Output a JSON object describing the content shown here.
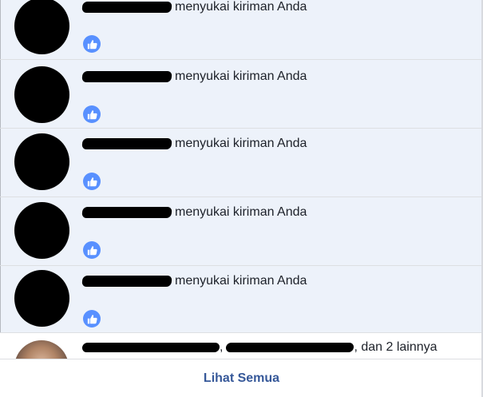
{
  "notifications": [
    {
      "actor_name": "",
      "action_text": "menyukai kiriman Anda",
      "reaction": "like-icon"
    },
    {
      "actor_name": "",
      "action_text": "menyukai kiriman Anda",
      "reaction": "like-icon"
    },
    {
      "actor_name": "",
      "action_text": "menyukai kiriman Anda",
      "reaction": "like-icon"
    },
    {
      "actor_name": "",
      "action_text": "menyukai kiriman Anda",
      "reaction": "like-icon"
    },
    {
      "actor_name": "",
      "action_text": "menyukai kiriman Anda",
      "reaction": "like-icon"
    }
  ],
  "last_notification": {
    "actor_1": "",
    "separator": ",",
    "actor_2": "",
    "suffix": ", dan 2 lainnya"
  },
  "footer": {
    "see_all_label": "Lihat Semua"
  },
  "colors": {
    "unread_background": "#edf2fa",
    "like_badge": "#5890ff",
    "link": "#365899",
    "redaction": "#000000"
  }
}
